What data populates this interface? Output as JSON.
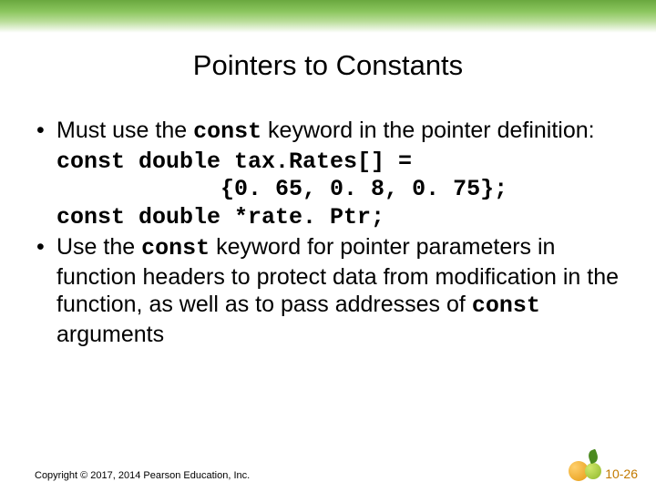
{
  "title": "Pointers to Constants",
  "bullet1": {
    "pre": "Must use the ",
    "kw": "const",
    "post": " keyword in the pointer definition:"
  },
  "code": {
    "line1": "const double tax.Rates[] =",
    "line2": "            {0. 65, 0. 8, 0. 75};",
    "line3": "const double *rate. Ptr;"
  },
  "bullet2": {
    "p1": "Use the ",
    "kw1": "const",
    "p2": " keyword for pointer parameters in function headers to protect data from modification in the function, as well as to pass addresses of ",
    "kw2": "const",
    "p3": " arguments"
  },
  "footer": {
    "copyright": "Copyright © 2017, 2014 Pearson Education, Inc.",
    "page": "10-26"
  }
}
